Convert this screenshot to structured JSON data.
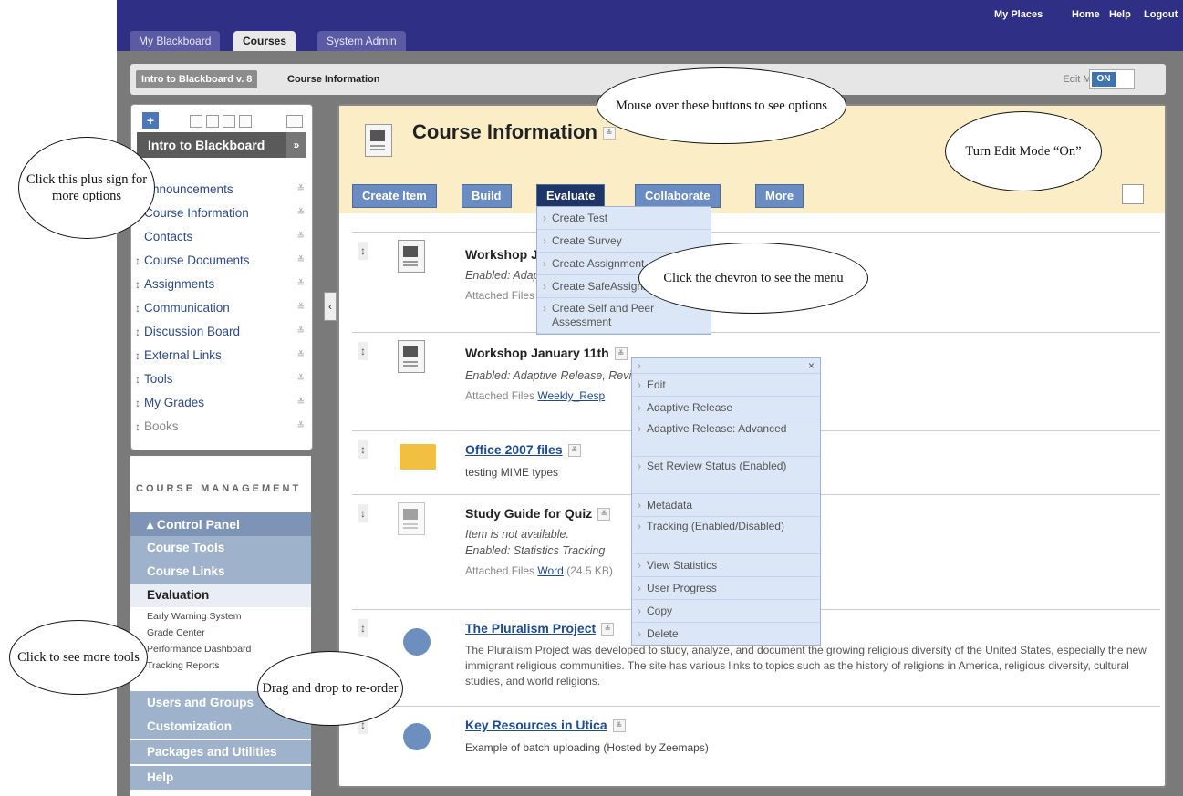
{
  "tabs": [
    "My Blackboard",
    "Courses",
    "System Admin"
  ],
  "top_links": [
    "My Places",
    "Home",
    "Help",
    "Logout"
  ],
  "breadcrumb": {
    "course": "Intro to Blackboard v. 8",
    "page": "Course Information"
  },
  "edit_mode": {
    "label": "Edit Mode:",
    "value": "ON"
  },
  "left_menu": {
    "course_title": "Intro to Blackboard",
    "items": [
      "Announcements",
      "Course Information",
      "Contacts",
      "Course Documents",
      "Assignments",
      "Communication",
      "Discussion Board",
      "External Links",
      "Tools",
      "My Grades",
      "Books"
    ]
  },
  "course_management": {
    "title": "COURSE MANAGEMENT",
    "control_panel": "Control Panel",
    "sections": [
      "Course Tools",
      "Course Links",
      "Evaluation"
    ],
    "evaluation_items": [
      "Early Warning System",
      "Grade Center",
      "Performance Dashboard",
      "Tracking Reports"
    ],
    "more_sections": [
      "Users and Groups",
      "Customization",
      "Packages and Utilities",
      "Help"
    ]
  },
  "content": {
    "title": "Course Information",
    "buttons": [
      "Create Item",
      "Build",
      "Evaluate",
      "Collaborate",
      "More"
    ],
    "evaluate_menu": [
      "Create Test",
      "Create Survey",
      "Create Assignment",
      "Create SafeAssignment",
      "Create Self and Peer Assessment"
    ],
    "items": [
      {
        "title": "Workshop January",
        "meta": "Enabled: Adaptive Release",
        "attach": "Attached Files"
      },
      {
        "title": "Workshop January 11th",
        "meta": "Enabled: Adaptive Release, Review",
        "attach": "Attached Files",
        "file": "Weekly_Resp"
      },
      {
        "title": "Office 2007 files",
        "desc": "testing MIME types"
      },
      {
        "title": "Study Guide for Quiz",
        "meta1": "Item is not available.",
        "meta2": "Enabled: Statistics Tracking",
        "attach": "Attached Files",
        "file": "Word",
        "size": "(24.5 KB)"
      },
      {
        "title": "The Pluralism Project",
        "desc": "The Pluralism Project was developed to study, analyze, and document the growing religious diversity of the United States, especially the new immigrant religious communities. The site has various links to topics such as the history of religions in America, religious diversity, cultural studies, and world religions."
      },
      {
        "title": "Key Resources in Utica",
        "desc": "Example of batch uploading (Hosted by Zeemaps)"
      }
    ],
    "context_menu": [
      "Edit",
      "Adaptive Release",
      "Adaptive Release: Advanced",
      "Set Review Status (Enabled)",
      "Metadata",
      "Tracking (Enabled/Disabled)",
      "View Statistics",
      "User Progress",
      "Copy",
      "Delete"
    ]
  },
  "callouts": {
    "plus": "Click this plus sign for more options",
    "mouse": "Mouse over these buttons to see options",
    "edit": "Turn Edit Mode “On”",
    "chevron": "Click the chevron to see the menu",
    "tools": "Click to see more tools",
    "drag": "Drag and drop to re-order"
  }
}
